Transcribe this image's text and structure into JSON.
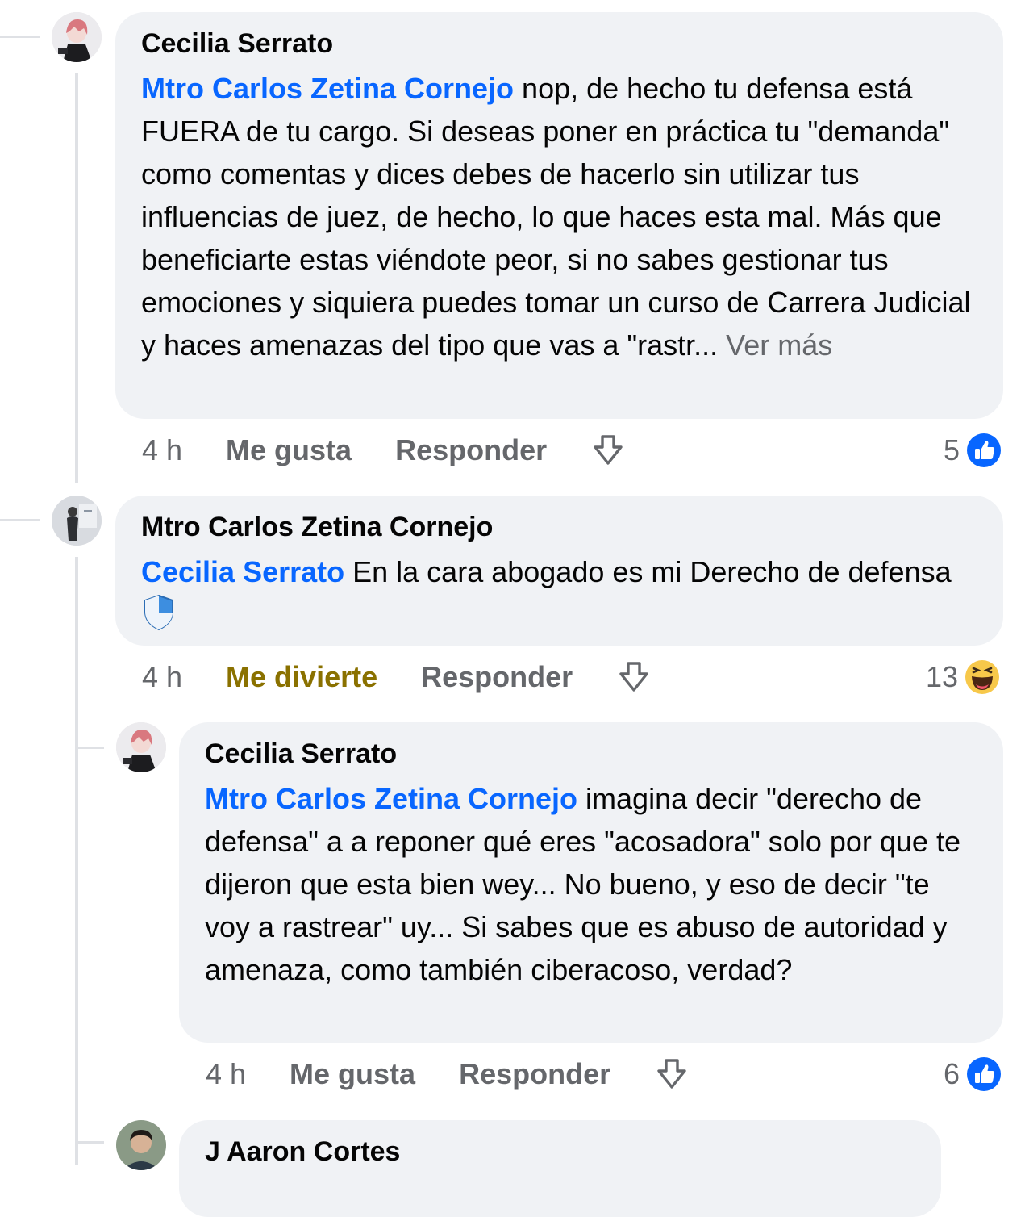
{
  "comments": [
    {
      "author": "Cecilia Serrato",
      "mention": "Mtro Carlos Zetina Cornejo",
      "text": " nop, de hecho tu defensa está FUERA de tu cargo. Si deseas poner en práctica tu \"demanda\" como comentas y dices debes de hacerlo sin utilizar tus influencias de juez, de hecho, lo que haces esta mal. Más que beneficiarte estas viéndote peor, si no sabes gestionar tus emociones y siquiera puedes tomar un curso de Carrera Judicial y haces amenazas del tipo que vas a \"rastr... ",
      "see_more": "Ver más",
      "time": "4 h",
      "react_label": "Me gusta",
      "reply_label": "Responder",
      "reaction_count": "5",
      "reaction_icon": "like-icon"
    },
    {
      "author": "Mtro Carlos Zetina Cornejo",
      "mention": "Cecilia Serrato",
      "text": " En la cara abogado es mi Derecho de defensa ",
      "emoji_icon": "shield-emoji-icon",
      "time": "4 h",
      "react_label": "Me divierte",
      "reply_label": "Responder",
      "reaction_count": "13",
      "reaction_icon": "haha-icon"
    },
    {
      "author": "Cecilia Serrato",
      "mention": "Mtro Carlos Zetina Cornejo",
      "text": " imagina decir \"derecho de defensa\" a a reponer qué eres \"acosadora\" solo por que te dijeron que esta bien wey... No bueno, y eso de decir \"te voy a rastrear\" uy... Si sabes que es abuso de autoridad y amenaza, como también ciberacoso, verdad?",
      "time": "4 h",
      "react_label": "Me gusta",
      "reply_label": "Responder",
      "reaction_count": "6",
      "reaction_icon": "like-icon"
    },
    {
      "author": "J Aaron Cortes"
    }
  ],
  "colors": {
    "mention": "#0866ff",
    "bubble": "#f0f2f5",
    "meta": "#65676b",
    "haha_label": "#8a7100"
  }
}
